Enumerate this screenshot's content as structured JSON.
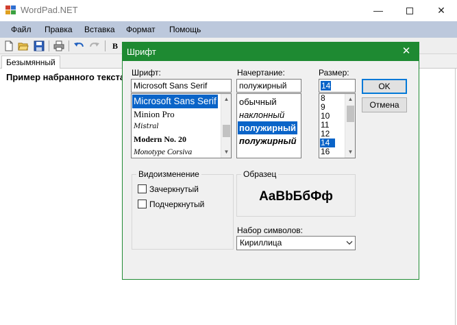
{
  "window": {
    "title": "WordPad.NET",
    "min_glyph": "—",
    "close_glyph": "✕"
  },
  "menu": [
    "Файл",
    "Правка",
    "Вставка",
    "Формат",
    "Помощь"
  ],
  "toolbar": {
    "icons": [
      "new-document-icon",
      "open-folder-icon",
      "save-icon",
      "print-icon",
      "undo-icon",
      "redo-icon"
    ],
    "bold_label": "B"
  },
  "tabs": [
    "Безымянный"
  ],
  "editor": {
    "text": "Пример набранного текста"
  },
  "font_dialog": {
    "title": "Шрифт",
    "close_glyph": "✕",
    "font": {
      "label": "Шрифт:",
      "value": "Microsoft Sans Serif",
      "items": [
        "Microsoft Sans Serif",
        "Minion Pro",
        "Mistral",
        "Modern No. 20",
        "Monotype Corsiva"
      ],
      "selected_index": 0
    },
    "style": {
      "label": "Начертание:",
      "value": "полужирный",
      "items": [
        "обычный",
        "наклонный",
        "полужирный",
        "полужирный"
      ],
      "selected_index": 2
    },
    "size": {
      "label": "Размер:",
      "value": "14",
      "items": [
        "8",
        "9",
        "10",
        "11",
        "12",
        "14",
        "16"
      ],
      "selected_index": 5
    },
    "ok_label": "OK",
    "cancel_label": "Отмена",
    "effects": {
      "title": "Видоизменение",
      "strikeout_label": "Зачеркнутый",
      "underline_label": "Подчеркнутый",
      "strikeout_checked": false,
      "underline_checked": false
    },
    "sample": {
      "title": "Образец",
      "text": "AaBbБбФф"
    },
    "charset": {
      "label": "Набор символов:",
      "value": "Кириллица"
    }
  },
  "colors": {
    "dialog_accent": "#1e8a32",
    "menubar": "#bcc8dc",
    "selection": "#0a64c8"
  }
}
